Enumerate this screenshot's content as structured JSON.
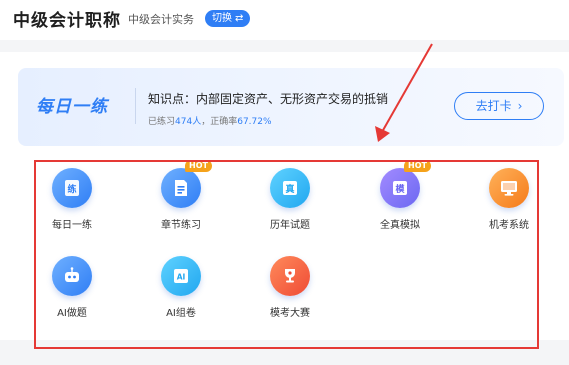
{
  "header": {
    "title": "中级会计职称",
    "subject": "中级会计实务",
    "switch_label": "切换",
    "switch_icon": "swap-arrows-icon"
  },
  "daily": {
    "logo_text": "每日一练",
    "knowledge_point": "知识点：内部固定资产、无形资产交易的抵销",
    "stats_prefix": "已练习",
    "practiced": "474人",
    "stats_mid": "，正确率",
    "accuracy": "67.72%",
    "clockin_label": "去打卡",
    "clockin_icon": "chevron-right-icon"
  },
  "tools": [
    {
      "label": "每日一练",
      "icon": "daily-practice-icon",
      "hot": false,
      "color": "#2f7ef5"
    },
    {
      "label": "章节练习",
      "icon": "document-icon",
      "hot": true,
      "color": "#2f7ef5"
    },
    {
      "label": "历年试题",
      "icon": "exam-paper-icon",
      "hot": false,
      "color": "#21a7f0"
    },
    {
      "label": "全真模拟",
      "icon": "mock-exam-icon",
      "hot": true,
      "color": "#6b68f2"
    },
    {
      "label": "机考系统",
      "icon": "computer-icon",
      "hot": false,
      "color": "#f57a1a"
    },
    {
      "label": "AI做题",
      "icon": "robot-icon",
      "hot": false,
      "color": "#2f7ef5"
    },
    {
      "label": "AI组卷",
      "icon": "ai-paper-icon",
      "hot": false,
      "color": "#21a7f0"
    },
    {
      "label": "模考大赛",
      "icon": "trophy-icon",
      "hot": false,
      "color": "#ef4b35"
    }
  ],
  "hot_badge": "HOT",
  "annotation": {
    "color": "#e53935"
  }
}
